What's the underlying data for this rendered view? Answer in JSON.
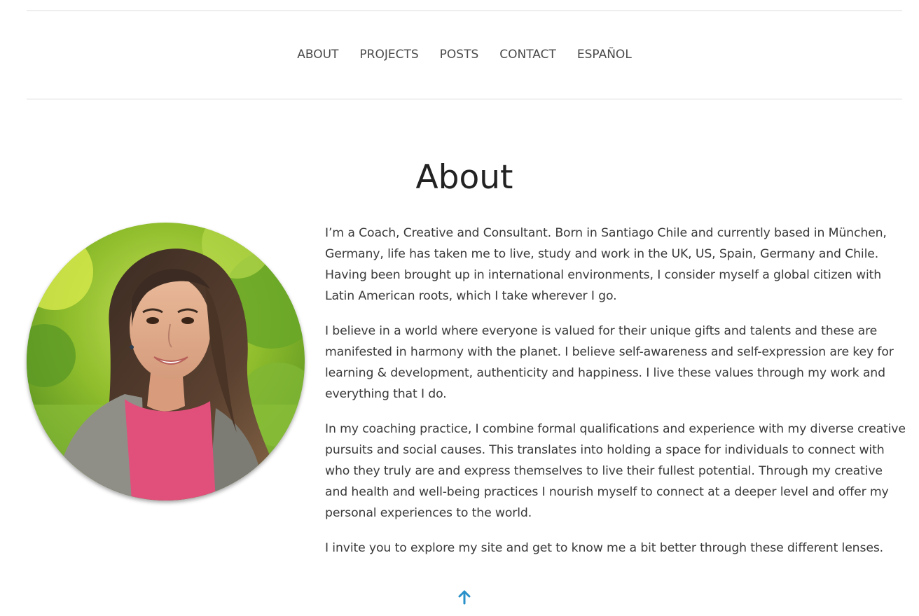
{
  "nav": {
    "items": [
      {
        "label": "ABOUT"
      },
      {
        "label": "PROJECTS"
      },
      {
        "label": "POSTS"
      },
      {
        "label": "CONTACT"
      },
      {
        "label": "ESPAÑOL"
      }
    ]
  },
  "main": {
    "title": "About",
    "paragraphs": [
      "I’m a Coach, Creative and Consultant. Born in Santiago Chile and currently based in München, Germany, life has taken me to live, study and work in the UK, US, Spain, Germany and Chile. Having been brought up in international environments, I consider myself a global citizen with Latin American roots, which I take wherever I go.",
      "I believe in a world where everyone is valued for their unique gifts and talents and these are manifested in harmony with the planet. I believe self-awareness and self-expression are key for learning & development, authenticity and happiness. I live these values through my work and everything that I do.",
      "In my coaching practice, I combine formal qualifications and experience with my diverse creative pursuits and social causes. This translates into holding a space for individuals to connect with who they truly are and express themselves to live their fullest potential. Through my creative and health and well-being practices I nourish myself to connect at a deeper level and offer my personal experiences to the world.",
      "I invite you to explore my site and get to know me a bit better through these different lenses."
    ]
  },
  "footer": {
    "back_to_top_icon": "arrow-up-icon"
  },
  "colors": {
    "accent": "#2a90c9",
    "text": "#3a3a3a",
    "rule": "#dcdcdc"
  }
}
